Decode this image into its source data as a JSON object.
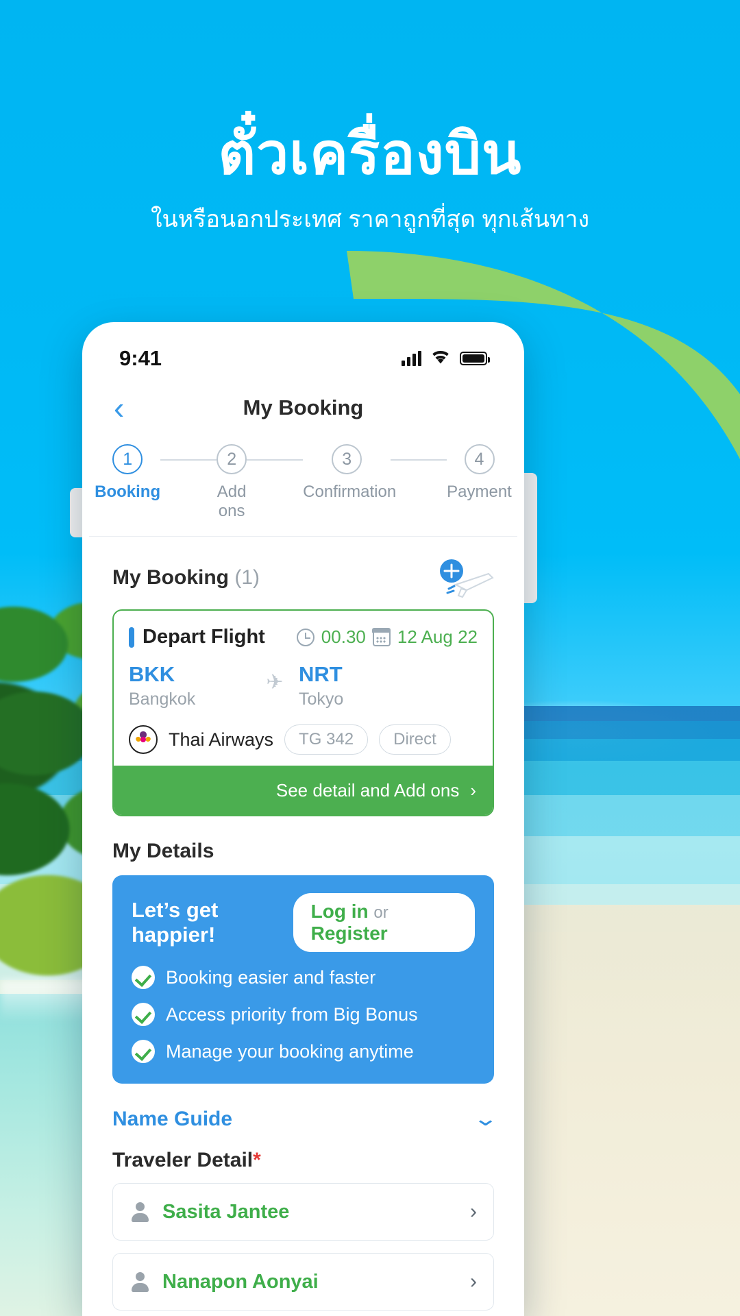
{
  "hero": {
    "title": "ตั๋วเครื่องบิน",
    "subtitle": "ในหรือนอกประเทศ ราคาถูกที่สุด ทุกเส้นทาง"
  },
  "colors": {
    "brand_blue": "#00b8f4",
    "accent_green": "#4caf50",
    "link_blue": "#2f8fe0",
    "promo_blue": "#3a9ae8",
    "required_red": "#e53935"
  },
  "status_bar": {
    "time": "9:41",
    "signal_icon": "signal-bars-icon",
    "wifi_icon": "wifi-icon",
    "battery_icon": "battery-full-icon"
  },
  "nav": {
    "back_icon": "chevron-left-icon",
    "title": "My Booking"
  },
  "stepper": {
    "steps": [
      {
        "number": "1",
        "label": "Booking",
        "active": true
      },
      {
        "number": "2",
        "label": "Add ons",
        "active": false
      },
      {
        "number": "3",
        "label": "Confirmation",
        "active": false
      },
      {
        "number": "4",
        "label": "Payment",
        "active": false
      }
    ]
  },
  "booking_section": {
    "title": "My Booking",
    "count": "(1)",
    "decor_icon": "airplane-illustration-icon"
  },
  "flight_card": {
    "label": "Depart Flight",
    "clock_icon": "clock-icon",
    "time": "00.30",
    "calendar_icon": "calendar-icon",
    "date": "12 Aug 22",
    "origin_code": "BKK",
    "origin_city": "Bangkok",
    "plane_icon": "airplane-icon",
    "destination_code": "NRT",
    "destination_city": "Tokyo",
    "airline_logo_icon": "thai-airways-logo-icon",
    "airline": "Thai Airways",
    "flight_number": "TG 342",
    "stops": "Direct",
    "cta_label": "See detail and Add ons",
    "cta_chevron_icon": "chevron-right-icon"
  },
  "details_section": {
    "title": "My Details"
  },
  "promo": {
    "title": "Let’s get happier!",
    "login_label": "Log in",
    "or_label": "or",
    "register_label": "Register",
    "benefits": [
      {
        "check_icon": "check-circle-icon",
        "text": "Booking easier and faster"
      },
      {
        "check_icon": "check-circle-icon",
        "text": "Access priority from Big Bonus"
      },
      {
        "check_icon": "check-circle-icon",
        "text": "Manage your booking anytime"
      }
    ]
  },
  "name_guide": {
    "label": "Name Guide",
    "chevron_icon": "chevron-down-icon"
  },
  "traveler": {
    "title": "Traveler Detail",
    "required_mark": "*",
    "rows": [
      {
        "person_icon": "person-icon",
        "name": "Sasita Jantee",
        "chevron_icon": "chevron-right-icon"
      },
      {
        "person_icon": "person-icon",
        "name": "Nanapon Aonyai",
        "chevron_icon": "chevron-right-icon"
      }
    ]
  }
}
